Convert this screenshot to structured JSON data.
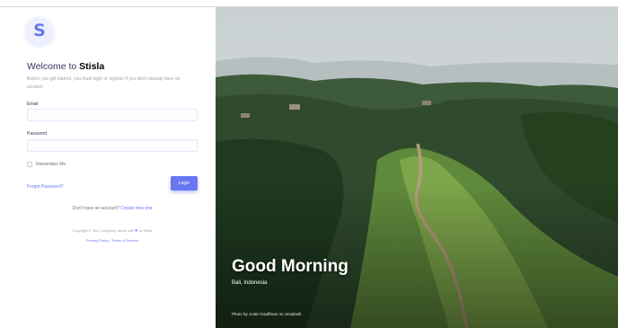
{
  "brand": {
    "logo_letter": "S"
  },
  "login": {
    "welcome_prefix": "Welcome to ",
    "welcome_brand": "Stisla",
    "subtext": "Before you get started, you must login or register if you don't already have an account.",
    "email_label": "Email",
    "email_value": "",
    "password_label": "Password",
    "password_value": "",
    "remember_label": "Remember Me",
    "forgot_link": "Forgot Password?",
    "login_button": "Login",
    "signup_prefix": "Don't have an account? ",
    "signup_link": "Create new one"
  },
  "footer": {
    "copyright_prefix": "Copyright © Your Company. Made with",
    "copyright_suffix": "by Stisla",
    "privacy_link": "Privacy Policy",
    "separator": "•",
    "terms_link": "Terms of Service"
  },
  "hero": {
    "greeting": "Good Morning",
    "location": "Bali, Indonesia",
    "credit": "Photo by Justin Kauffman on Unsplash"
  },
  "colors": {
    "primary": "#6777ef",
    "text": "#34395e",
    "muted": "#98a6ad"
  },
  "icons": {
    "heart": "heart-icon",
    "checkbox": "checkbox-icon"
  }
}
